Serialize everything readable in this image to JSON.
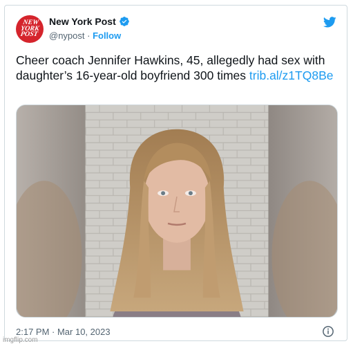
{
  "account": {
    "avatar_text": "NEW\nYORK\nPOST",
    "name": "New York Post",
    "handle": "@nypost",
    "separator": " · ",
    "follow_label": "Follow",
    "verified_icon": "verified-badge-icon"
  },
  "tweet": {
    "text": "Cheer coach Jennifer Hawkins, 45, allegedly had sex with daughter’s 16-year-old boyfriend 300 times ",
    "link": "trib.al​/z1TQ8Be",
    "image_description_icon": "mugshot-photo",
    "timestamp": "2:17 PM · Mar 10, 2023"
  },
  "icons": {
    "platform": "twitter-bird-icon",
    "info": "info-icon"
  },
  "watermark": "imgflip.com",
  "colors": {
    "accent": "#1d9bf0",
    "brand_red": "#d5242c",
    "text": "#0f1419",
    "muted": "#536471"
  }
}
